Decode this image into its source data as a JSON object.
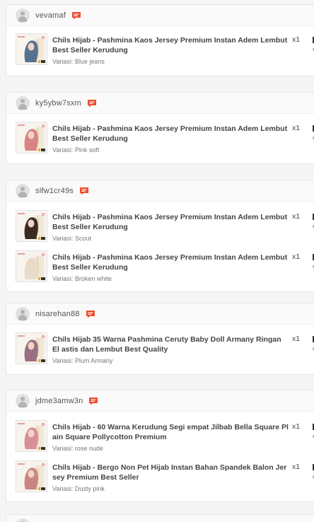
{
  "orders": [
    {
      "username": "vevamaf",
      "items": [
        {
          "title": "Chils Hijab - Pashmina Kaos Jersey Premium Instan Adem Lembut Best Seller Kerudung",
          "variant": "Variasi: Blue jeans",
          "qty": "x1",
          "color": "#56708f"
        }
      ]
    },
    {
      "username": "ky5ybw7sxm",
      "items": [
        {
          "title": "Chils Hijab - Pashmina Kaos Jersey Premium Instan Adem Lembut Best Seller Kerudung",
          "variant": "Variasi: Pink soft",
          "qty": "x1",
          "color": "#d98384"
        }
      ]
    },
    {
      "username": "slfw1cr49s",
      "items": [
        {
          "title": "Chils Hijab - Pashmina Kaos Jersey Premium Instan Adem Lembut Best Seller Kerudung",
          "variant": "Variasi: Scout",
          "qty": "x1",
          "color": "#3b2a23"
        },
        {
          "title": "Chils Hijab - Pashmina Kaos Jersey Premium Instan Adem Lembut Best Seller Kerudung",
          "variant": "Variasi: Broken white",
          "qty": "x1",
          "color": "#e4ddc9"
        }
      ]
    },
    {
      "username": "nisarehan88",
      "items": [
        {
          "title": "Chils Hijab 35 Warna Pashmina Ceruty Baby Doll Armany Ringan El astis dan Lembut Best Quality",
          "variant": "Variasi: Plum Armany",
          "qty": "x1",
          "color": "#9a6e82"
        }
      ]
    },
    {
      "username": "jdme3amw3n",
      "items": [
        {
          "title": "Chils Hijab - 60 Warna Kerudung Segi empat Jilbab Bella Square Pl ain Square Pollycotton Premium",
          "variant": "Variasi: rose nude",
          "qty": "x1",
          "color": "#d88f97"
        },
        {
          "title": "Chils Hijab - Bergo Non Pet Hijab Instan Bahan Spandek Balon Jer sey Premium Best Seller",
          "variant": "Variasi: Dusty pink",
          "qty": "x1",
          "color": "#c98582"
        }
      ]
    },
    {
      "username": "",
      "items": []
    }
  ],
  "colors": {
    "chat_icon": "#ee4d2d",
    "background": "#f5f5f5"
  },
  "icons": {
    "avatar": "user-avatar-icon",
    "chat": "chat-bubble-icon"
  }
}
